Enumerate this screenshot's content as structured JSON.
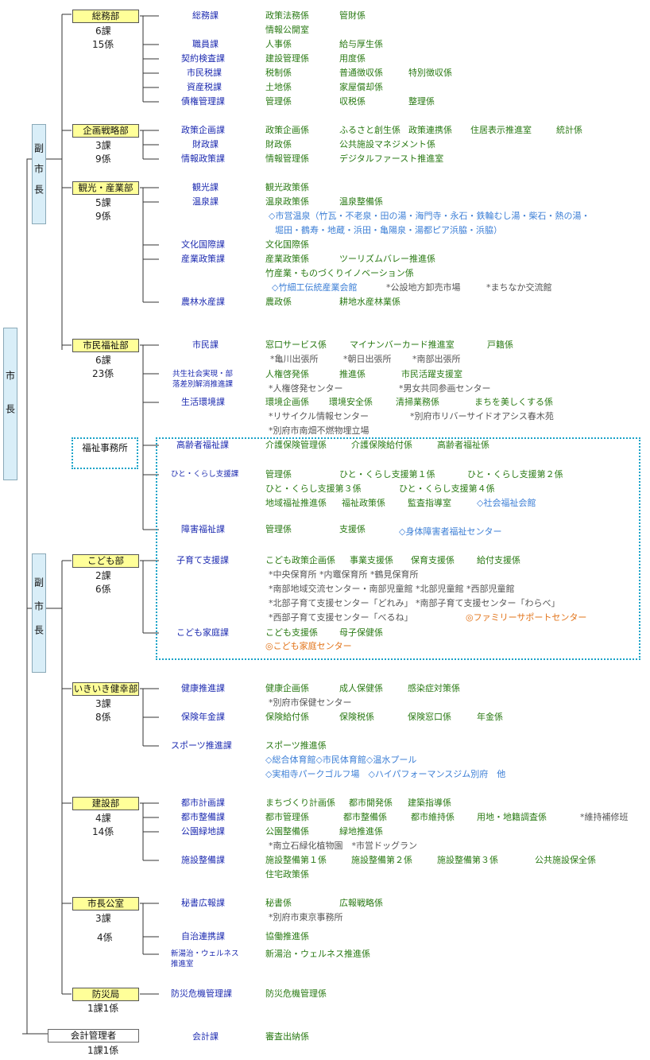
{
  "mayor": "市長",
  "vice_mayor_1": "副市長",
  "vice_mayor_2": "副市長",
  "accounting": {
    "name": "会計管理者",
    "counts": "1課1係",
    "dept": "会計課",
    "sections": "審査出納係"
  },
  "welfare_office": "福祉事務所",
  "bureaus": [
    {
      "name": "総務部",
      "c1": "6課",
      "c2": "15係"
    },
    {
      "name": "企画戦略部",
      "c1": "3課",
      "c2": "9係"
    },
    {
      "name": "観光・産業部",
      "c1": "5課",
      "c2": "9係"
    },
    {
      "name": "市民福祉部",
      "c1": "6課",
      "c2": "23係"
    },
    {
      "name": "こども部",
      "c1": "2課",
      "c2": "6係"
    },
    {
      "name": "いきいき健幸部",
      "c1": "3課",
      "c2": "8係"
    },
    {
      "name": "建設部",
      "c1": "4課",
      "c2": "14係"
    },
    {
      "name": "市長公室",
      "c1": "3課",
      "c2": "4係"
    },
    {
      "name": "防災局",
      "c1": "1課1係",
      "c2": ""
    }
  ],
  "departments": [
    {
      "name": "総務課",
      "lines": [
        [
          "政策法務係",
          "管財係"
        ],
        [
          "情報公開室"
        ]
      ]
    },
    {
      "name": "職員課",
      "lines": [
        [
          "人事係",
          "給与厚生係"
        ]
      ]
    },
    {
      "name": "契約検査課",
      "lines": [
        [
          "建設管理係",
          "用度係"
        ]
      ]
    },
    {
      "name": "市民税課",
      "lines": [
        [
          "税制係",
          "普通徴収係",
          "特別徴収係"
        ]
      ]
    },
    {
      "name": "資産税課",
      "lines": [
        [
          "土地係",
          "家屋償却係"
        ]
      ]
    },
    {
      "name": "債権管理課",
      "lines": [
        [
          "管理係",
          "収税係",
          "整理係"
        ]
      ]
    },
    {
      "name": "政策企画課",
      "lines": [
        [
          "政策企画係",
          "ふるさと創生係",
          "政策連携係",
          "住居表示推進室",
          "統計係"
        ]
      ]
    },
    {
      "name": "財政課",
      "lines": [
        [
          "財政係",
          "公共施設マネジメント係"
        ]
      ]
    },
    {
      "name": "情報政策課",
      "lines": [
        [
          "情報管理係",
          "デジタルファースト推進室"
        ]
      ]
    },
    {
      "name": "観光課",
      "lines": [
        [
          "観光政策係"
        ]
      ]
    },
    {
      "name": "温泉課",
      "lines": [
        [
          "温泉政策係",
          "温泉整備係"
        ]
      ]
    },
    {
      "name": "文化国際課",
      "lines": [
        [
          "文化国際係"
        ]
      ]
    },
    {
      "name": "産業政策課",
      "lines": [
        [
          "産業政策係",
          "ツーリズムバレー推進係"
        ],
        [
          "竹産業・ものづくりイノベーション係"
        ]
      ]
    },
    {
      "name": "農林水産課",
      "lines": [
        [
          "農政係",
          "耕地水産林業係"
        ]
      ]
    },
    {
      "name": "市民課",
      "lines": [
        [
          "窓口サービス係",
          "マイナンバーカード推進室",
          "戸籍係"
        ]
      ]
    },
    {
      "name": "共生社会実現・部\n落差別解消推進課",
      "lines": [
        [
          "人権啓発係",
          "推進係",
          "市民活躍支援室"
        ]
      ]
    },
    {
      "name": "生活環境課",
      "lines": [
        [
          "環境企画係",
          "環境安全係",
          "清掃業務係",
          "まちを美しくする係"
        ]
      ]
    },
    {
      "name": "高齢者福祉課",
      "lines": [
        [
          "介護保険管理係",
          "介護保険給付係",
          "高齢者福祉係"
        ]
      ]
    },
    {
      "name": "ひと・くらし支援課",
      "lines": [
        [
          "管理係",
          "ひと・くらし支援第１係",
          "ひと・くらし支援第２係"
        ],
        [
          "ひと・くらし支援第３係",
          "ひと・くらし支援第４係"
        ],
        [
          "地域福祉推進係",
          "福祉政策係",
          "監査指導室"
        ]
      ]
    },
    {
      "name": "障害福祉課",
      "lines": [
        [
          "管理係",
          "支援係"
        ]
      ]
    },
    {
      "name": "子育て支援課",
      "lines": [
        [
          "こども政策企画係",
          "事業支援係",
          "保育支援係",
          "給付支援係"
        ]
      ]
    },
    {
      "name": "こども家庭課",
      "lines": [
        [
          "こども支援係",
          "母子保健係"
        ]
      ]
    },
    {
      "name": "健康推進課",
      "lines": [
        [
          "健康企画係",
          "成人保健係",
          "感染症対策係"
        ]
      ]
    },
    {
      "name": "保険年金課",
      "lines": [
        [
          "保険給付係",
          "保険税係",
          "保険窓口係",
          "年金係"
        ]
      ]
    },
    {
      "name": "スポーツ推進課",
      "lines": [
        [
          "スポーツ推進係"
        ]
      ]
    },
    {
      "name": "都市計画課",
      "lines": [
        [
          "まちづくり計画係",
          "都市開発係",
          "建築指導係"
        ]
      ]
    },
    {
      "name": "都市整備課",
      "lines": [
        [
          "都市管理係",
          "都市整備係",
          "都市維持係",
          "用地・地籍調査係"
        ]
      ]
    },
    {
      "name": "公園緑地課",
      "lines": [
        [
          "公園整備係",
          "緑地推進係"
        ]
      ]
    },
    {
      "name": "施設整備課",
      "lines": [
        [
          "施設整備第１係",
          "施設整備第２係",
          "施設整備第３係",
          "公共施設保全係"
        ],
        [
          "住宅政策係"
        ]
      ]
    },
    {
      "name": "秘書広報課",
      "lines": [
        [
          "秘書係",
          "広報戦略係"
        ]
      ]
    },
    {
      "name": "自治連携課",
      "lines": [
        [
          "協働推進係"
        ]
      ]
    },
    {
      "name": "新湯治・ウェルネス\n推進室",
      "lines": [
        [
          "新湯治・ウェルネス推進係"
        ]
      ]
    },
    {
      "name": "防災危機管理課",
      "lines": [
        [
          "防災危機管理係"
        ]
      ]
    }
  ],
  "facilities": [
    "◇市営温泉（竹瓦・不老泉・田の湯・海門寺・永石・鉄輪むし湯・柴石・熱の湯・",
    "堀田・鶴寿・地蔵・浜田・亀陽泉・湯都ピア浜脇・浜脇）",
    "◇竹細工伝統産業会館",
    "*公設地方卸売市場",
    "*まちなか交流館",
    "*亀川出張所",
    "*朝日出張所",
    "*南部出張所",
    "*人権啓発センター",
    "*男女共同参画センター",
    "*リサイクル情報センター",
    "*別府市リバーサイドオアシス春木苑",
    "*別府市南畑不燃物埋立場",
    "◇社会福祉会館",
    "◇身体障害者福祉センター",
    "*中央保育所 *内竈保育所 *鶴見保育所",
    "*南部地域交流センター・南部児童館 *北部児童館 *西部児童館",
    "*北部子育て支援センター「どれみ」 *南部子育て支援センター「わらべ」",
    "*西部子育て支援センター「べるね」",
    "◎ファミリーサポートセンター",
    "◎こども家庭センター",
    "*別府市保健センター",
    "◇総合体育館◇市民体育館◇温水プール",
    "◇実相寺パークゴルフ場　◇ハイパフォーマンスジム別府　他",
    "*維持補修班",
    "*南立石緑化植物園　*市営ドッグラン",
    "*別府市東京事務所"
  ]
}
